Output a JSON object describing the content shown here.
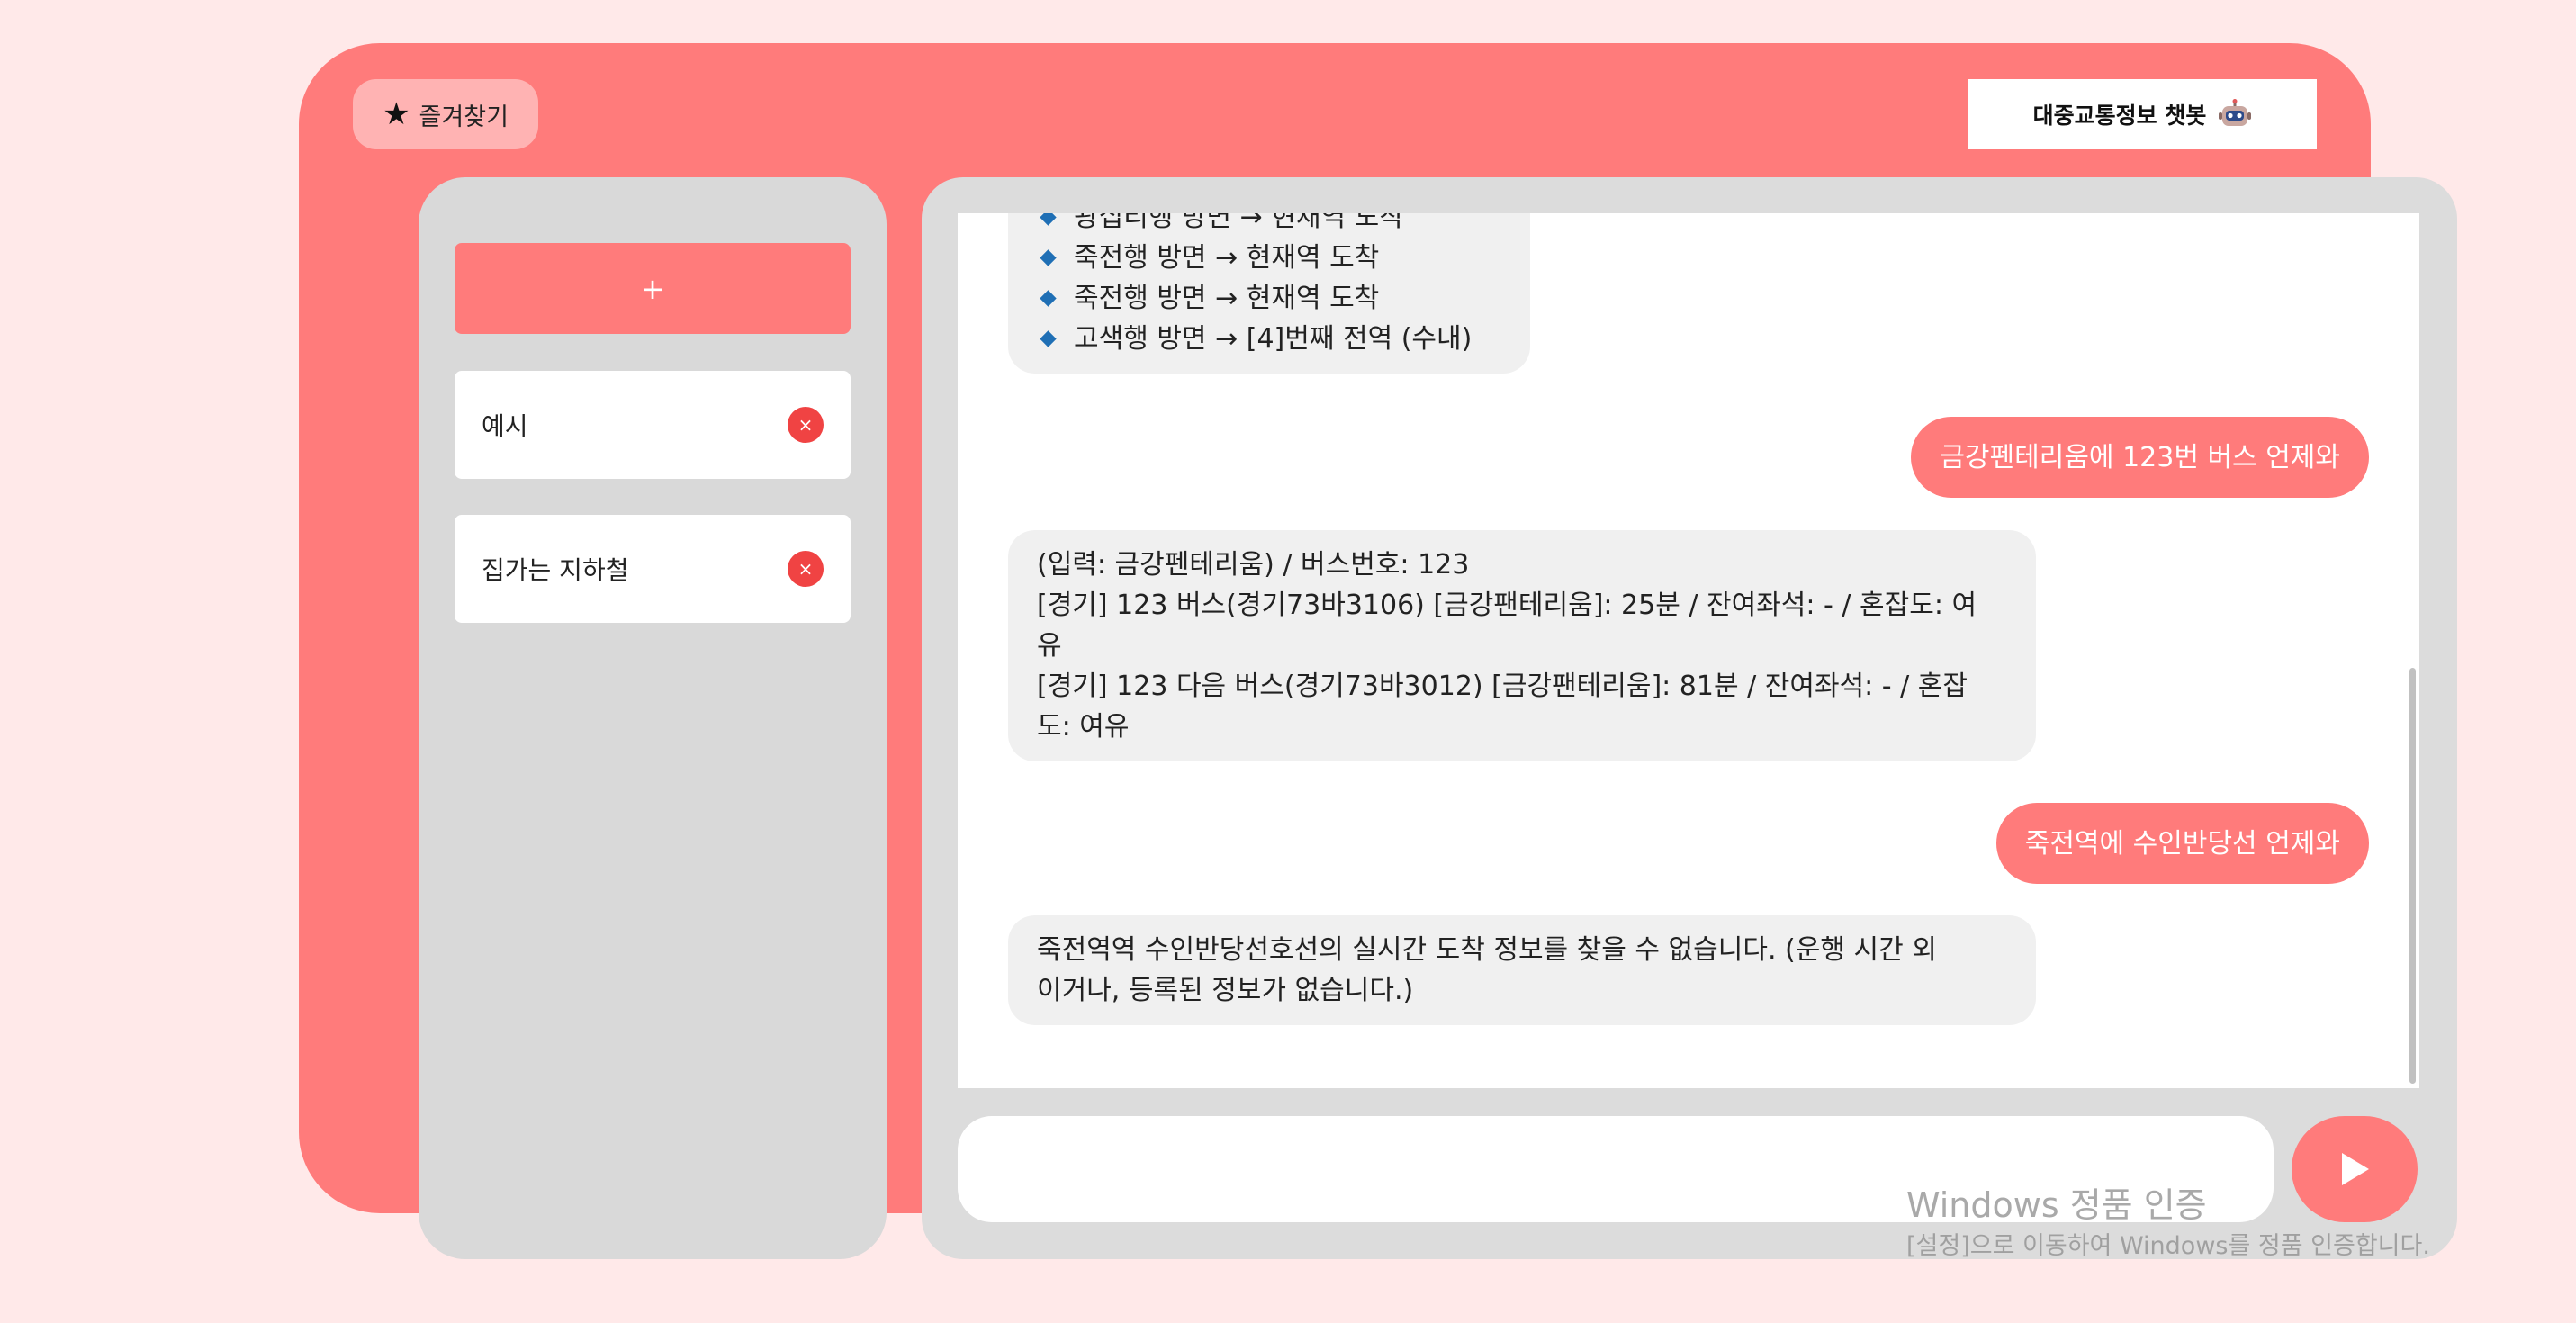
{
  "header": {
    "favorites_label": "즐겨찾기",
    "star_glyph": "★",
    "app_title": "대중교통정보 챗봇"
  },
  "sidebar": {
    "new_chat_label": "+",
    "sessions": [
      {
        "label": "예시",
        "delete_glyph": "×"
      },
      {
        "label": "집가는 지하철",
        "delete_glyph": "×"
      }
    ]
  },
  "chat": {
    "messages": [
      {
        "role": "bot",
        "lines": [
          "왕십리행 방면 → 현재역 도착",
          "죽전행 방면 → 현재역 도착",
          "죽전행 방면 → 현재역 도착",
          "고색행 방면 → [4]번째 전역 (수내)"
        ]
      },
      {
        "role": "user",
        "text": "금강펜테리움에 123번 버스 언제와"
      },
      {
        "role": "bot",
        "lines": [
          "(입력: 금강펜테리움) / 버스번호: 123",
          "[경기] 123 버스(경기73바3106) [금강팬테리움]: 25분 / 잔여좌석: - / 혼잡도: 여",
          "유",
          "[경기] 123 다음 버스(경기73바3012) [금강팬테리움]: 81분 / 잔여좌석: - / 혼잡",
          "도: 여유"
        ]
      },
      {
        "role": "user",
        "text": "죽전역에 수인반당선 언제와"
      },
      {
        "role": "bot",
        "lines": [
          "죽전역역 수인반당선호선의 실시간 도착 정보를 찾을 수 없습니다. (운행 시간 외",
          "이거나, 등록된 정보가 없습니다.)"
        ]
      }
    ]
  },
  "input": {
    "value": "",
    "placeholder": ""
  },
  "watermark": {
    "title": "Windows 정품 인증",
    "subtitle": "[설정]으로 이동하여 Windows를 정품 인증합니다."
  },
  "colors": {
    "accent": "#ff7b7b",
    "page_bg": "#ffe9e9",
    "panel_gray": "#d9d9d9",
    "delete_red": "#f04343",
    "bullet_blue": "#1f6fb5"
  }
}
